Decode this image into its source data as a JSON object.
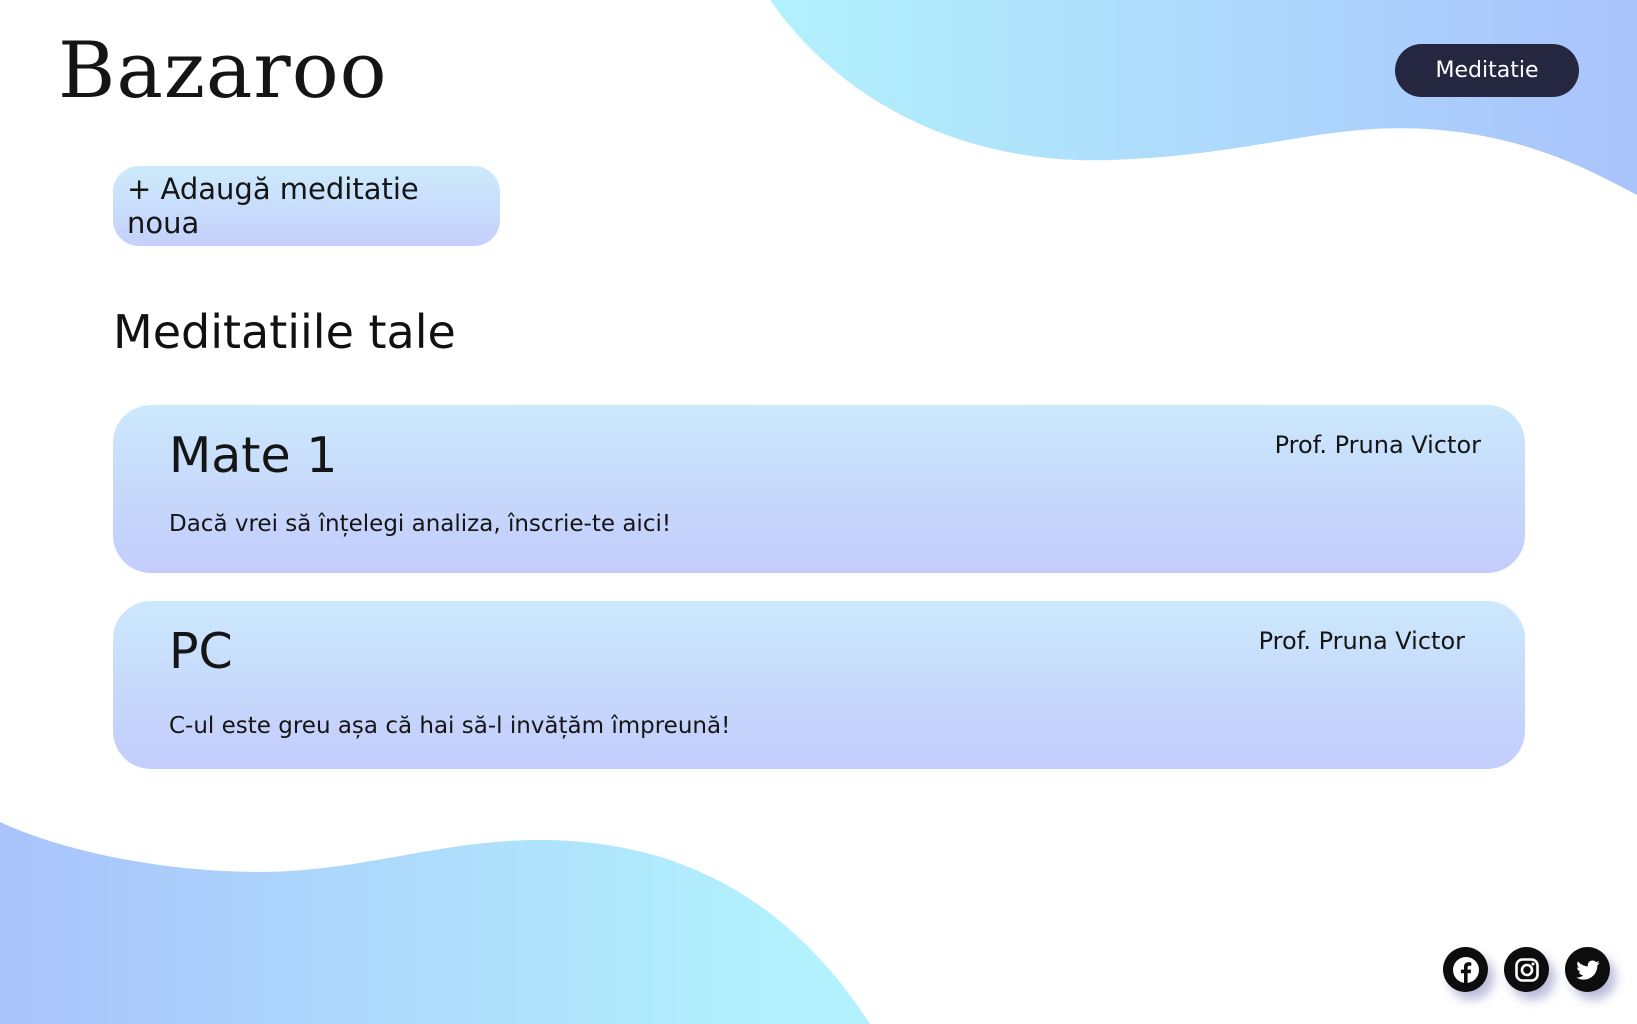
{
  "header": {
    "logo_text": "Bazaroo",
    "nav_button_label": "Meditatie"
  },
  "actions": {
    "add_label": "+ Adaugă meditatie noua"
  },
  "section": {
    "title": "Meditatiile tale"
  },
  "meditations": [
    {
      "title": "Mate 1",
      "professor": "Prof. Pruna Victor",
      "description": "Dacă vrei să înțelegi analiza, înscrie-te aici!"
    },
    {
      "title": "PC",
      "professor": "Prof. Pruna Victor",
      "description": "C-ul este greu așa că hai să-l invățăm împreună!"
    }
  ],
  "footer": {
    "social_icons": [
      "facebook-icon",
      "instagram-icon",
      "twitter-icon"
    ]
  },
  "colors": {
    "nav_button_bg": "#25263f",
    "card_gradient_top": "#cce9fc",
    "card_gradient_bottom": "#c3cdfc",
    "blob_cyan": "#b2f1fd",
    "blob_blue": "#a9c3fb"
  }
}
